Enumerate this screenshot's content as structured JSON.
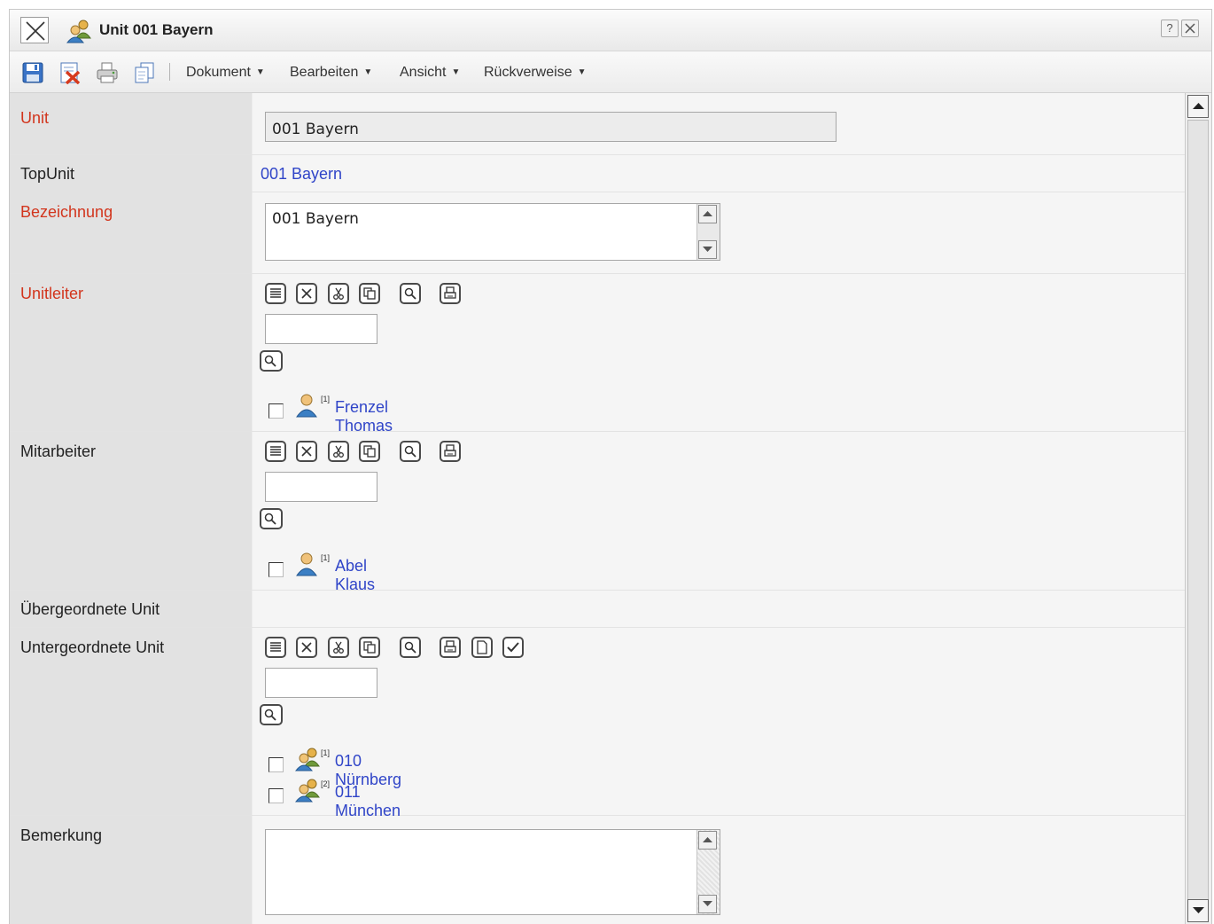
{
  "window": {
    "title": "Unit 001 Bayern",
    "help_label": "?"
  },
  "toolbar": {
    "menus": [
      {
        "label": "Dokument"
      },
      {
        "label": "Bearbeiten"
      },
      {
        "label": "Ansicht"
      },
      {
        "label": "Rückverweise"
      }
    ]
  },
  "fields": {
    "unit": {
      "label": "Unit",
      "value": "001 Bayern"
    },
    "topunit": {
      "label": "TopUnit",
      "value": "001 Bayern"
    },
    "bezeichnung": {
      "label": "Bezeichnung",
      "value": "001 Bayern"
    },
    "unitleiter": {
      "label": "Unitleiter",
      "entries": [
        {
          "index": "[1]",
          "name": "Frenzel Thomas"
        }
      ]
    },
    "mitarbeiter": {
      "label": "Mitarbeiter",
      "entries": [
        {
          "index": "[1]",
          "name": "Abel Klaus"
        }
      ]
    },
    "uebergeordnete": {
      "label": "Übergeordnete Unit"
    },
    "untergeordnete": {
      "label": "Untergeordnete Unit",
      "entries": [
        {
          "index": "[1]",
          "name": "010 Nürnberg"
        },
        {
          "index": "[2]",
          "name": "011 München"
        }
      ]
    },
    "bemerkung": {
      "label": "Bemerkung",
      "value": ""
    }
  },
  "colors": {
    "required_label": "#d2351d",
    "link": "#3045c8"
  }
}
